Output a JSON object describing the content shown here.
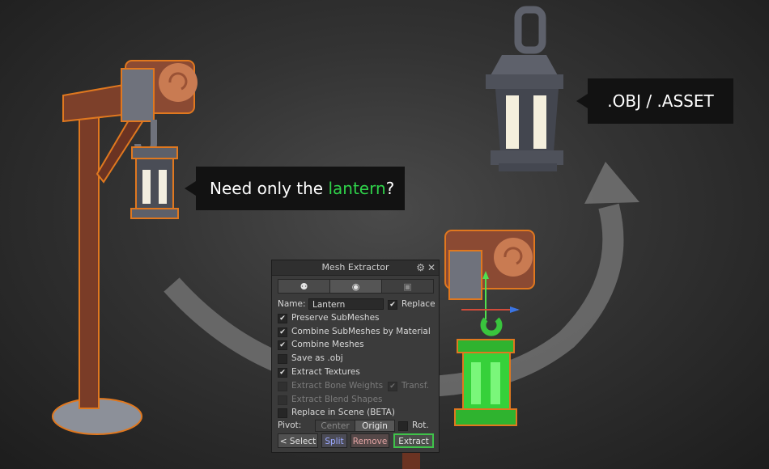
{
  "callouts": {
    "lantern_prefix": "Need only the ",
    "lantern_accent": "lantern",
    "lantern_suffix": "?",
    "export_formats": ".OBJ / .ASSET"
  },
  "panel": {
    "title": "Mesh Extractor",
    "name_label": "Name:",
    "name_value": "Lantern",
    "replace_label": "Replace",
    "options": {
      "preserve_submeshes": "Preserve SubMeshes",
      "combine_submeshes": "Combine SubMeshes by Material",
      "combine_meshes": "Combine Meshes",
      "save_as_obj": "Save as .obj",
      "extract_textures": "Extract Textures",
      "extract_bone_weights": "Extract Bone Weights",
      "transf": "Transf.",
      "extract_blend_shapes": "Extract Blend Shapes",
      "replace_in_scene": "Replace in Scene (BETA)"
    },
    "pivot_label": "Pivot:",
    "pivot_center": "Center",
    "pivot_origin": "Origin",
    "rot_label": "Rot.",
    "buttons": {
      "select": "< Select",
      "split": "Split",
      "remove": "Remove",
      "extract": "Extract"
    }
  },
  "colors": {
    "accent_green": "#2fd24a",
    "extract_border": "#3fc24a",
    "split_text": "#9aa8ff",
    "remove_text": "#e2a3a3"
  }
}
